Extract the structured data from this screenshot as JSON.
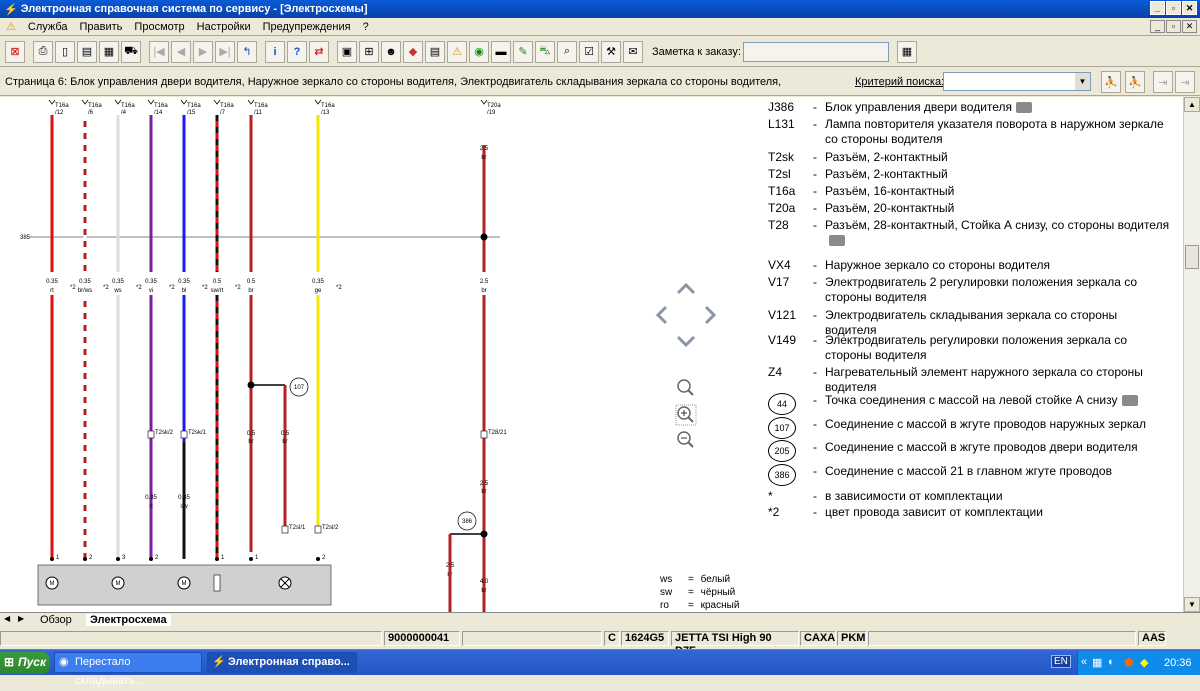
{
  "window": {
    "title": "Электронная справочная система по сервису - [Электросхемы]"
  },
  "menu": [
    "Служба",
    "Править",
    "Просмотр",
    "Настройки",
    "Предупреждения",
    "?"
  ],
  "toolbar": {
    "order_note_label": "Заметка к заказу:",
    "order_note_value": ""
  },
  "infobar": {
    "page_text": "Страница 6: Блок управления двери водителя, Наружное зеркало со стороны водителя, Электродвигатель складывания зеркала со стороны водителя,",
    "search_label": "Критерий поиска:",
    "search_value": ""
  },
  "diagram": {
    "wires": [
      {
        "conn": "T16a",
        "pin": "/12",
        "gauge": "0.35",
        "color_code": "rt",
        "note": "*2",
        "stroke": "#dd1111",
        "stripe": ""
      },
      {
        "conn": "T16a",
        "pin": "/6",
        "gauge": "0.35",
        "color_code": "br/ws",
        "note": "*2",
        "stroke": "#b22222",
        "stripe": "#ffffff"
      },
      {
        "conn": "T16a",
        "pin": "/4",
        "gauge": "0.35",
        "color_code": "ws",
        "note": "*2",
        "stroke": "#dddddd",
        "stripe": ""
      },
      {
        "conn": "T16a",
        "pin": "/14",
        "gauge": "0.35",
        "color_code": "vi",
        "note": "*2",
        "stroke": "#7b1fa2",
        "stripe": ""
      },
      {
        "conn": "T16a",
        "pin": "/15",
        "gauge": "0.35",
        "color_code": "bl",
        "note": "*2",
        "stroke": "#1a1aee",
        "stripe": ""
      },
      {
        "conn": "T16a",
        "pin": "/7",
        "gauge": "0.5",
        "color_code": "sw/rt",
        "note": "*2",
        "stroke": "#dd1111",
        "stripe": "#111111"
      },
      {
        "conn": "T16a",
        "pin": "/11",
        "gauge": "0.5",
        "color_code": "br",
        "note": "",
        "stroke": "#b22222",
        "stripe": ""
      },
      {
        "conn": "T16a",
        "pin": "/13",
        "gauge": "0.35",
        "color_code": "ge",
        "note": "*2",
        "stroke": "#f2e600",
        "stripe": ""
      },
      {
        "conn": "T20a",
        "pin": "/19",
        "gauge": "2.5",
        "color_code": "br",
        "note": "",
        "stroke": "#b22222",
        "stripe": ""
      }
    ],
    "lower_wires": [
      {
        "gauge": "0.35",
        "color_code": "rt"
      },
      {
        "gauge": "0.35",
        "color_code": "sw"
      },
      {
        "gauge": "0.5",
        "color_code": "br"
      },
      {
        "gauge": "0.5",
        "color_code": "br"
      },
      {
        "gauge": "2.5",
        "color_code": "br"
      },
      {
        "gauge": "2.5",
        "color_code": "br"
      },
      {
        "gauge": "4.0",
        "color_code": "br"
      }
    ],
    "connectors": [
      "T2sk/2",
      "T2sk/1",
      "T28/21",
      "T2sl/1",
      "T2sl/2"
    ],
    "ground_points": [
      "107",
      "386"
    ],
    "line_ref": "385",
    "pins": [
      "1",
      "2",
      "3",
      "2",
      "1",
      "1",
      "2"
    ]
  },
  "color_legend": [
    {
      "code": "ws",
      "name": "белый"
    },
    {
      "code": "sw",
      "name": "чёрный"
    },
    {
      "code": "ro",
      "name": "красный"
    }
  ],
  "legend": [
    {
      "code": "J386",
      "desc": "Блок управления двери водителя",
      "camera": true
    },
    {
      "code": "L131",
      "desc": "Лампа повторителя указателя поворота в наружном зеркале со стороны водителя",
      "camera": false
    },
    {
      "code": "T2sk",
      "desc": "Разъём, 2-контактный",
      "camera": false
    },
    {
      "code": "T2sl",
      "desc": "Разъём, 2-контактный",
      "camera": false
    },
    {
      "code": "T16a",
      "desc": "Разъём, 16-контактный",
      "camera": false
    },
    {
      "code": "T20a",
      "desc": "Разъём, 20-контактный",
      "camera": false
    },
    {
      "code": "T28",
      "desc": "Разъём, 28-контактный, Стойка А снизу, со стороны водителя",
      "camera": true
    },
    {
      "code": "VX4",
      "desc": "Наружное зеркало со стороны водителя",
      "camera": false
    },
    {
      "code": "V17",
      "desc": "Электродвигатель 2 регулировки положения зеркала со стороны водителя",
      "camera": false
    },
    {
      "code": "V121",
      "desc": "Электродвигатель складывания зеркала со стороны водителя",
      "camera": false
    },
    {
      "code": "V149",
      "desc": "Электродвигатель регулировки положения зеркала со стороны водителя",
      "camera": false
    },
    {
      "code": "Z4",
      "desc": "Нагревательный элемент наружного зеркала со стороны водителя",
      "camera": false
    },
    {
      "code": "44",
      "desc": "Точка соединения с массой на левой стойке А снизу",
      "camera": true,
      "circle": true
    },
    {
      "code": "107",
      "desc": "Соединение с массой в жгуте проводов наружных зеркал",
      "camera": false,
      "circle": true
    },
    {
      "code": "205",
      "desc": "Соединение с массой в жгуте проводов двери водителя",
      "camera": false,
      "circle": true
    },
    {
      "code": "386",
      "desc": "Соединение с массой 21 в главном жгуте проводов",
      "camera": false,
      "circle": true
    },
    {
      "code": "*",
      "desc": "в зависимости от комплектации",
      "camera": false
    },
    {
      "code": "*2",
      "desc": "цвет провода зависит от комплектации",
      "camera": false
    }
  ],
  "tabs": [
    "Обзор",
    "Электросхема"
  ],
  "status": {
    "order": "9000000041",
    "c": "C",
    "code": "1624G5",
    "model": "JETTA TSI High 90 D7F",
    "engine": "CAXA",
    "gear": "PKM",
    "right": "AAS"
  },
  "taskbar": {
    "start": "Пуск",
    "tasks": [
      "Перестало складывать...",
      "Электронная справо..."
    ],
    "lang": "EN",
    "time": "20:36"
  }
}
